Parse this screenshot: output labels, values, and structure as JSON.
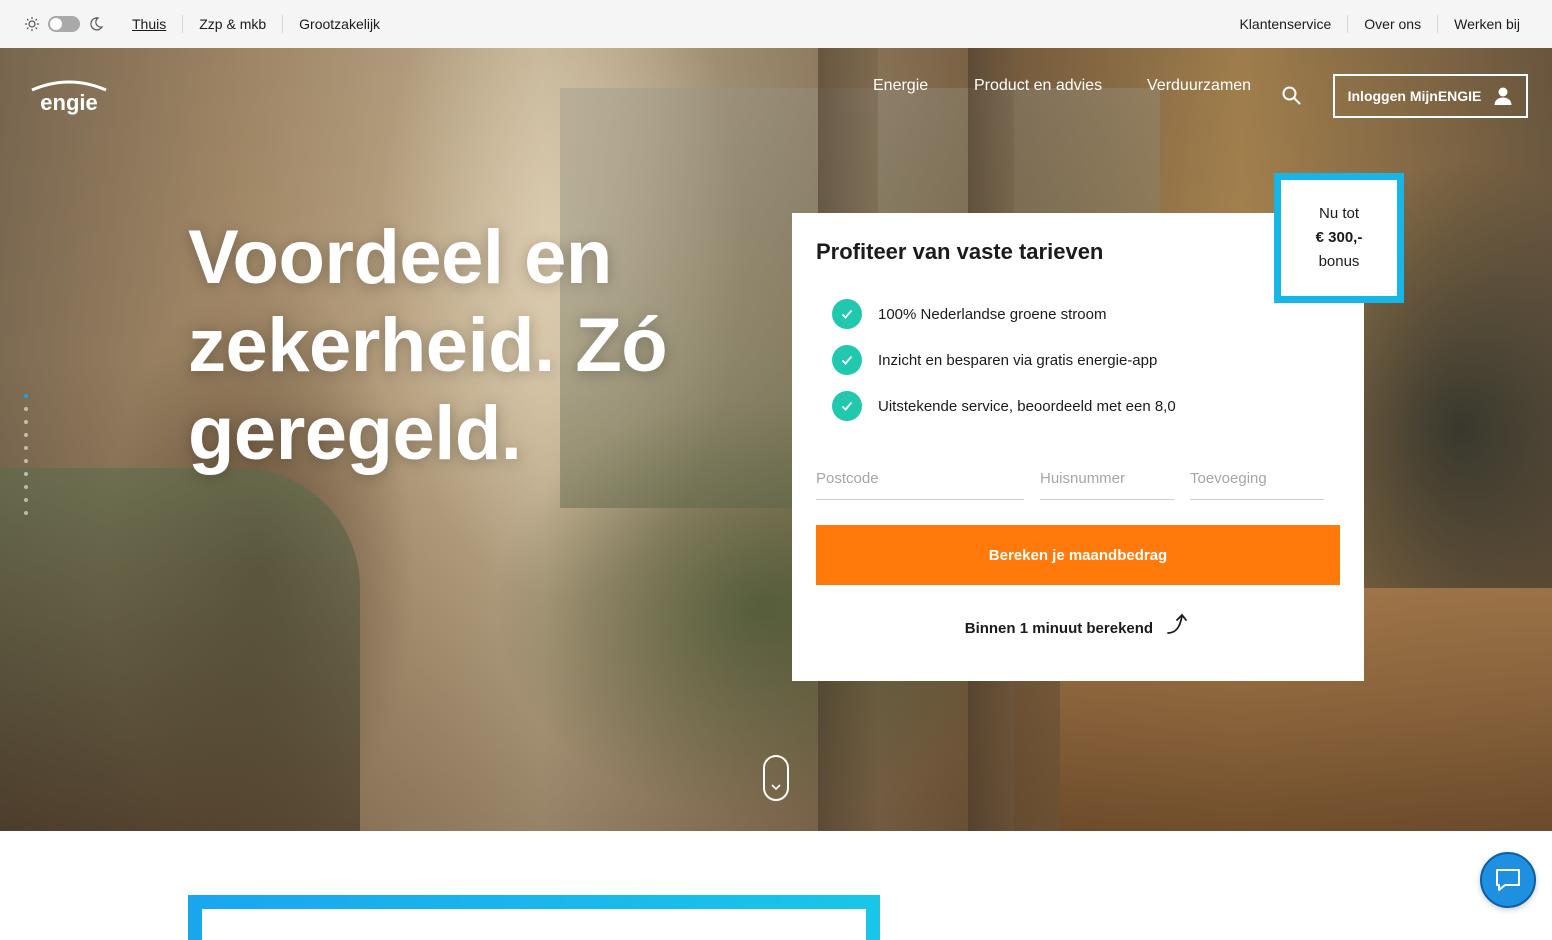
{
  "utility_bar": {
    "theme_toggle": {
      "light_icon": "sun-icon",
      "dark_icon": "moon-icon",
      "state": "light"
    },
    "segments": [
      {
        "label": "Thuis",
        "active": true
      },
      {
        "label": "Zzp & mkb",
        "active": false
      },
      {
        "label": "Grootzakelijk",
        "active": false
      }
    ],
    "links": [
      {
        "label": "Klantenservice"
      },
      {
        "label": "Over ons"
      },
      {
        "label": "Werken bij"
      }
    ]
  },
  "header": {
    "logo_text": "engie",
    "nav": [
      {
        "label": "Energie"
      },
      {
        "label": "Product en advies"
      },
      {
        "label": "Verduurzamen"
      }
    ],
    "search_icon": "search-icon",
    "login_label": "Inloggen MijnENGIE",
    "login_icon": "user-icon"
  },
  "hero": {
    "headline_lines": [
      "Voordeel en",
      "zekerheid. Zó",
      "geregeld."
    ],
    "slide_dots": 10,
    "active_dot": 1,
    "scroll_icon": "chevron-down-icon"
  },
  "offer_card": {
    "title": "Profiteer van vaste tarieven",
    "benefits": [
      "100% Nederlandse groene stroom",
      "Inzicht en besparen via gratis energie-app",
      "Uitstekende service, beoordeeld met een 8,0"
    ],
    "fields": {
      "postcode_placeholder": "Postcode",
      "huisnummer_placeholder": "Huisnummer",
      "toevoeging_placeholder": "Toevoeging"
    },
    "cta_label": "Bereken je maandbedrag",
    "cta_note": "Binnen 1 minuut berekend"
  },
  "badge": {
    "line1": "Nu tot",
    "amount": "€ 300,-",
    "line3": "bonus"
  },
  "colors": {
    "cta_orange": "#ff7a0b",
    "check_green": "#22c8ae",
    "badge_blue": "#18b6e6",
    "chat_blue": "#1f8fe0"
  },
  "chat": {
    "icon": "chat-icon"
  }
}
